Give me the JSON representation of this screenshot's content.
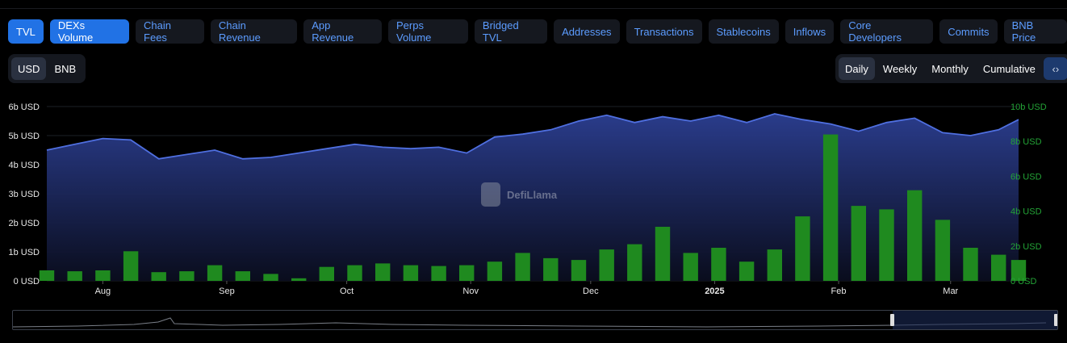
{
  "metric_tabs": [
    "TVL",
    "DEXs Volume",
    "Chain Fees",
    "Chain Revenue",
    "App Revenue",
    "Perps Volume",
    "Bridged TVL",
    "Addresses",
    "Transactions",
    "Stablecoins",
    "Inflows",
    "Core Developers",
    "Commits",
    "BNB Price"
  ],
  "active_tabs": [
    "TVL",
    "DEXs Volume"
  ],
  "currency_toggle": {
    "options": [
      "USD",
      "BNB"
    ],
    "selected": "USD"
  },
  "period_toggle": {
    "options": [
      "Daily",
      "Weekly",
      "Monthly",
      "Cumulative"
    ],
    "selected": "Daily",
    "embed_icon": "code-brackets-icon"
  },
  "watermark": "DefiLlama",
  "colors": {
    "tvl_line": "#4f6fe0",
    "tvl_fill_top": "#2c3f92",
    "volume_bar": "#1f8a1f",
    "right_axis_text": "#23a336",
    "active_tab": "#2172e5",
    "tab_text": "#5c9cff"
  },
  "chart_data": {
    "type": "area",
    "x_ticks": [
      "Aug",
      "Sep",
      "Oct",
      "Nov",
      "Dec",
      "2025",
      "Feb",
      "Mar"
    ],
    "x_range": [
      "2024-07-18",
      "2025-03-18"
    ],
    "left_axis": {
      "ticks": [
        "0 USD",
        "1b USD",
        "2b USD",
        "3b USD",
        "4b USD",
        "5b USD",
        "6b USD"
      ],
      "range": [
        0,
        6000000000
      ]
    },
    "right_axis": {
      "ticks": [
        "0 USD",
        "2b USD",
        "4b USD",
        "6b USD",
        "8b USD",
        "10b USD"
      ],
      "range": [
        0,
        10000000000
      ]
    },
    "grid": true,
    "series": [
      {
        "name": "TVL",
        "kind": "area",
        "axis": "left",
        "x": [
          "2024-07-18",
          "2024-07-25",
          "2024-08-01",
          "2024-08-08",
          "2024-08-15",
          "2024-08-22",
          "2024-08-29",
          "2024-09-05",
          "2024-09-12",
          "2024-09-19",
          "2024-09-26",
          "2024-10-03",
          "2024-10-10",
          "2024-10-17",
          "2024-10-24",
          "2024-10-31",
          "2024-11-07",
          "2024-11-14",
          "2024-11-21",
          "2024-11-28",
          "2024-12-05",
          "2024-12-12",
          "2024-12-19",
          "2024-12-26",
          "2025-01-02",
          "2025-01-09",
          "2025-01-16",
          "2025-01-23",
          "2025-01-30",
          "2025-02-06",
          "2025-02-13",
          "2025-02-20",
          "2025-02-27",
          "2025-03-06",
          "2025-03-13",
          "2025-03-18"
        ],
        "values": [
          4.5,
          4.7,
          4.9,
          4.85,
          4.2,
          4.35,
          4.5,
          4.2,
          4.25,
          4.4,
          4.55,
          4.7,
          4.6,
          4.55,
          4.6,
          4.4,
          4.95,
          5.05,
          5.2,
          5.5,
          5.7,
          5.45,
          5.65,
          5.5,
          5.7,
          5.45,
          5.75,
          5.55,
          5.4,
          5.15,
          5.45,
          5.6,
          5.1,
          5.0,
          5.2,
          5.55
        ]
      },
      {
        "name": "DEXs Volume",
        "kind": "bar",
        "axis": "right",
        "x": [
          "2024-07-18",
          "2024-07-25",
          "2024-08-01",
          "2024-08-08",
          "2024-08-15",
          "2024-08-22",
          "2024-08-29",
          "2024-09-05",
          "2024-09-12",
          "2024-09-19",
          "2024-09-26",
          "2024-10-03",
          "2024-10-10",
          "2024-10-17",
          "2024-10-24",
          "2024-10-31",
          "2024-11-07",
          "2024-11-14",
          "2024-11-21",
          "2024-11-28",
          "2024-12-05",
          "2024-12-12",
          "2024-12-19",
          "2024-12-26",
          "2025-01-02",
          "2025-01-09",
          "2025-01-16",
          "2025-01-23",
          "2025-01-30",
          "2025-02-06",
          "2025-02-13",
          "2025-02-20",
          "2025-02-27",
          "2025-03-06",
          "2025-03-13",
          "2025-03-18"
        ],
        "values": [
          0.6,
          0.55,
          0.6,
          1.7,
          0.5,
          0.55,
          0.9,
          0.55,
          0.4,
          0.15,
          0.8,
          0.9,
          1.0,
          0.9,
          0.85,
          0.9,
          1.1,
          1.6,
          1.3,
          1.2,
          1.8,
          2.1,
          3.1,
          1.6,
          1.9,
          1.1,
          1.8,
          3.7,
          8.4,
          4.3,
          4.1,
          5.2,
          3.5,
          1.9,
          1.5,
          1.2
        ]
      }
    ]
  }
}
